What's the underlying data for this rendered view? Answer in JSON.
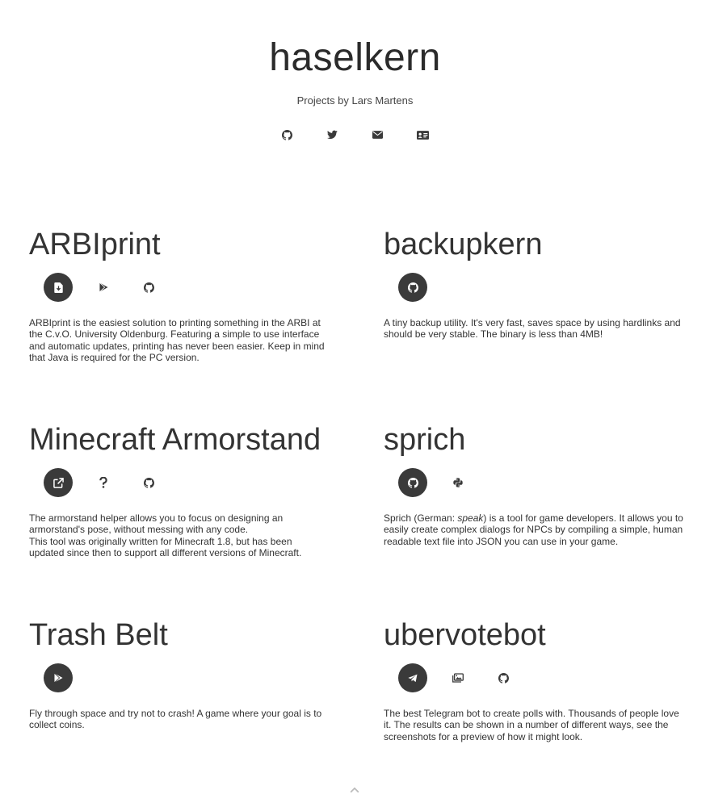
{
  "header": {
    "title": "haselkern",
    "subtitle": "Projects by Lars Martens",
    "social": [
      {
        "icon": "github-icon"
      },
      {
        "icon": "twitter-icon"
      },
      {
        "icon": "envelope-icon"
      },
      {
        "icon": "id-card-icon"
      }
    ]
  },
  "projects": [
    {
      "title": "ARBIprint",
      "links": [
        "download-file-icon",
        "google-play-icon",
        "github-icon"
      ],
      "description": "ARBIprint is the easiest solution to printing something in the ARBI at the C.v.O. University Oldenburg. Featuring a simple to use interface and automatic updates, printing has never been easier. Keep in mind that Java is required for the PC version."
    },
    {
      "title": "backupkern",
      "links": [
        "github-icon"
      ],
      "description": "A tiny backup utility. It's very fast, saves space by using hardlinks and should be very stable. The binary is less than 4MB!"
    },
    {
      "title": "Minecraft Armorstand",
      "links": [
        "external-link-icon",
        "question-icon",
        "github-icon"
      ],
      "description_line1": "The armorstand helper allows you to focus on designing an armorstand's pose, without messing with any code.",
      "description_line2": "This tool was originally written for Minecraft 1.8, but has been updated since then to support all different versions of Minecraft."
    },
    {
      "title": "sprich",
      "links": [
        "github-icon",
        "python-icon"
      ],
      "description_before": "Sprich (German: ",
      "description_em": "speak",
      "description_after": ") is a tool for game developers. It allows you to easily create complex dialogs for NPCs by compiling a simple, human readable text file into JSON you can use in your game."
    },
    {
      "title": "Trash Belt",
      "links": [
        "google-play-icon"
      ],
      "description": "Fly through space and try not to crash! A game where your goal is to collect coins."
    },
    {
      "title": "ubervotebot",
      "links": [
        "telegram-icon",
        "images-icon",
        "github-icon"
      ],
      "description": "The best Telegram bot to create polls with. Thousands of people love it. The results can be shown in a number of different ways, see the screenshots for a preview of how it might look."
    }
  ],
  "footer": {
    "back_to_top_icon": "chevron-up-icon"
  },
  "colors": {
    "text": "#333333",
    "button_dark": "#3a3a3a",
    "chevron": "#bbbbbb"
  }
}
